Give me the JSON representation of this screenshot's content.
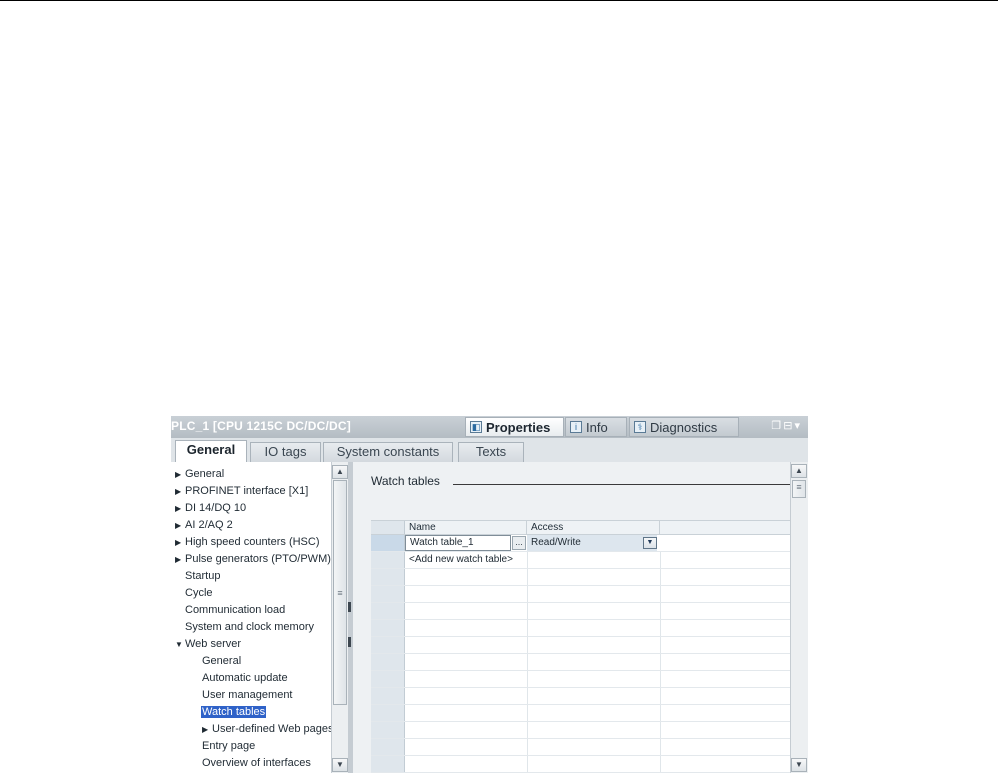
{
  "window": {
    "title": "PLC_1 [CPU 1215C DC/DC/DC]",
    "panel_tabs": [
      {
        "label": "Properties",
        "icon": "properties-icon"
      },
      {
        "label": "Info",
        "icon": "info-icon"
      },
      {
        "label": "Diagnostics",
        "icon": "diagnostics-icon"
      }
    ]
  },
  "tabs": [
    "General",
    "IO tags",
    "System constants",
    "Texts"
  ],
  "tree": {
    "items": [
      {
        "label": "General",
        "arrow": "▶"
      },
      {
        "label": "PROFINET interface [X1]",
        "arrow": "▶"
      },
      {
        "label": "DI 14/DQ 10",
        "arrow": "▶"
      },
      {
        "label": "AI 2/AQ 2",
        "arrow": "▶"
      },
      {
        "label": "High speed counters (HSC)",
        "arrow": "▶"
      },
      {
        "label": "Pulse generators (PTO/PWM)",
        "arrow": "▶"
      },
      {
        "label": "Startup",
        "arrow": ""
      },
      {
        "label": "Cycle",
        "arrow": ""
      },
      {
        "label": "Communication load",
        "arrow": ""
      },
      {
        "label": "System and clock memory",
        "arrow": ""
      },
      {
        "label": "Web server",
        "arrow": "▼"
      },
      {
        "label": "General",
        "arrow": ""
      },
      {
        "label": "Automatic update",
        "arrow": ""
      },
      {
        "label": "User management",
        "arrow": ""
      },
      {
        "label": "Watch tables",
        "arrow": ""
      },
      {
        "label": "User-defined Web pages",
        "arrow": "▶"
      },
      {
        "label": "Entry page",
        "arrow": ""
      },
      {
        "label": "Overview of interfaces",
        "arrow": ""
      }
    ]
  },
  "content": {
    "section_title": "Watch tables",
    "columns": [
      "Name",
      "Access"
    ],
    "rows": [
      {
        "name": "Watch table_1",
        "access": "Read/Write"
      }
    ],
    "add_row": "<Add new watch table>"
  }
}
